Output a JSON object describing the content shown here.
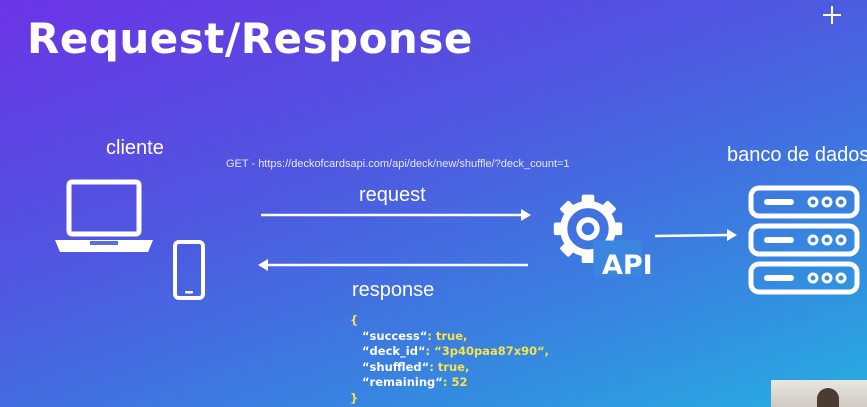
{
  "slide": {
    "title": "Request/Response",
    "client_label": "cliente",
    "db_label": "banco de dados",
    "get_line": "GET -  https://deckofcardsapi.com/api/deck/new/shuffle/?deck_count=1",
    "request_label": "request",
    "response_label": "response",
    "api_label": "API"
  },
  "json_body": {
    "open": "{",
    "close": "}",
    "lines": [
      {
        "key": "“success“",
        "sep": ": ",
        "value": "true,"
      },
      {
        "key": "“deck_id“",
        "sep": ": ",
        "value": "“3p40paa87x90“,"
      },
      {
        "key": "“shuffled“",
        "sep": ": ",
        "value": "true,"
      },
      {
        "key": "“remaining“",
        "sep": ": ",
        "value": "52"
      }
    ]
  },
  "colors": {
    "json_value": "#f7e34a",
    "icon": "#ffffff",
    "background_start": "#6b34e6",
    "background_end": "#26aee0"
  },
  "icons": [
    "plus-icon",
    "laptop-icon",
    "smartphone-icon",
    "gear-icon",
    "server-icon",
    "request-arrow-icon",
    "response-arrow-icon",
    "api-to-db-arrow-icon"
  ]
}
